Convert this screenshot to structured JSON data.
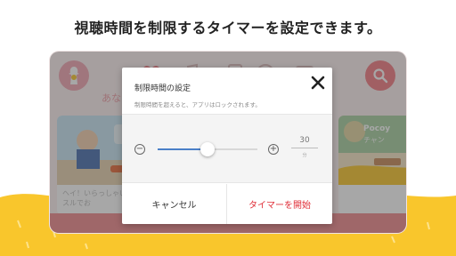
{
  "promo": {
    "caption": "視聴時間を制限するタイマーを設定できます。"
  },
  "app": {
    "section_title": "あな",
    "cards": [
      {
        "caption_line1": "ヘイ！いらっしゃい",
        "caption_line2": "スルでお"
      },
      {
        "title": "Pocoy",
        "subtitle": "チャン"
      }
    ]
  },
  "dialog": {
    "title": "制限時間の設定",
    "description": "制限時間を超えると、アプリはロックされます。",
    "minus_label": "−",
    "plus_label": "+",
    "minutes_value": "30",
    "minutes_unit": "分",
    "slider_level": 0.5,
    "cancel_label": "キャンセル",
    "start_label": "タイマーを開始"
  },
  "colors": {
    "yellow": "#f9c62c",
    "pink": "#f08a8f",
    "accent_red": "#e0303a",
    "slider_blue": "#4a7fc8"
  },
  "icons": [
    "kids-logo-icon",
    "search-icon",
    "close-icon",
    "minus-icon",
    "plus-icon",
    "nav-heart-icon",
    "nav-music-icon",
    "nav-book-icon",
    "nav-smile-icon",
    "nav-tv-icon"
  ]
}
